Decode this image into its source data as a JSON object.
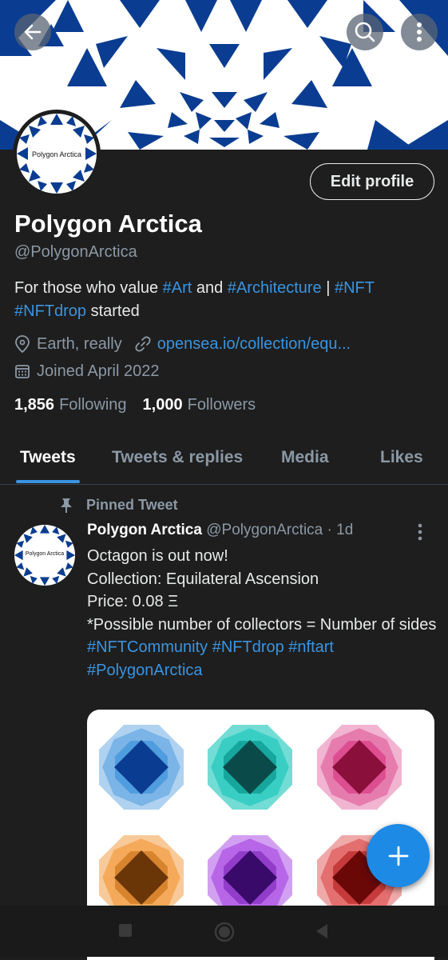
{
  "profile": {
    "name": "Polygon Arctica",
    "handle": "@PolygonArctica",
    "avatar_text": "Polygon Arctica",
    "bio": {
      "part1": "For those who value ",
      "tag1": "#Art",
      "part2": " and ",
      "tag2": "#Architecture",
      "part3": " | ",
      "tag3": "#NFT",
      "tag4": "#NFTdrop",
      "part4": " started"
    },
    "location": "Earth, really",
    "website": "opensea.io/collection/equ...",
    "joined": "Joined April 2022",
    "following_count": "1,856",
    "following_label": "Following",
    "followers_count": "1,000",
    "followers_label": "Followers",
    "edit_label": "Edit profile"
  },
  "tabs": [
    "Tweets",
    "Tweets & replies",
    "Media",
    "Likes"
  ],
  "tweet": {
    "pinned_label": "Pinned Tweet",
    "author": "Polygon Arctica",
    "handle": "@PolygonArctica",
    "time": "· 1d",
    "avatar_text": "Polygon Arctica",
    "line1": "Octagon is out now!",
    "line2": "Collection: Equilateral Ascension",
    "line3": "Price: 0.08 Ξ",
    "line4": "*Possible number of collectors = Number of sides",
    "tags1": "#NFTCommunity #NFTdrop #nftart",
    "tags2": "#PolygonArctica"
  },
  "colors": {
    "accent": "#1d8ae6",
    "link": "#3a94e0",
    "background": "#1e1e1e",
    "banner_blue": "#0a3d91",
    "octagons": [
      "#1a7ed4",
      "#00bfb3",
      "#d6287a",
      "#f08a1c",
      "#9b2ce0",
      "#d62828"
    ]
  },
  "icons": {
    "back": "arrow-left-icon",
    "search": "search-icon",
    "more": "more-vertical-icon",
    "location": "location-pin-icon",
    "link": "link-icon",
    "calendar": "calendar-icon",
    "pin": "pin-icon",
    "compose": "plus-icon"
  }
}
